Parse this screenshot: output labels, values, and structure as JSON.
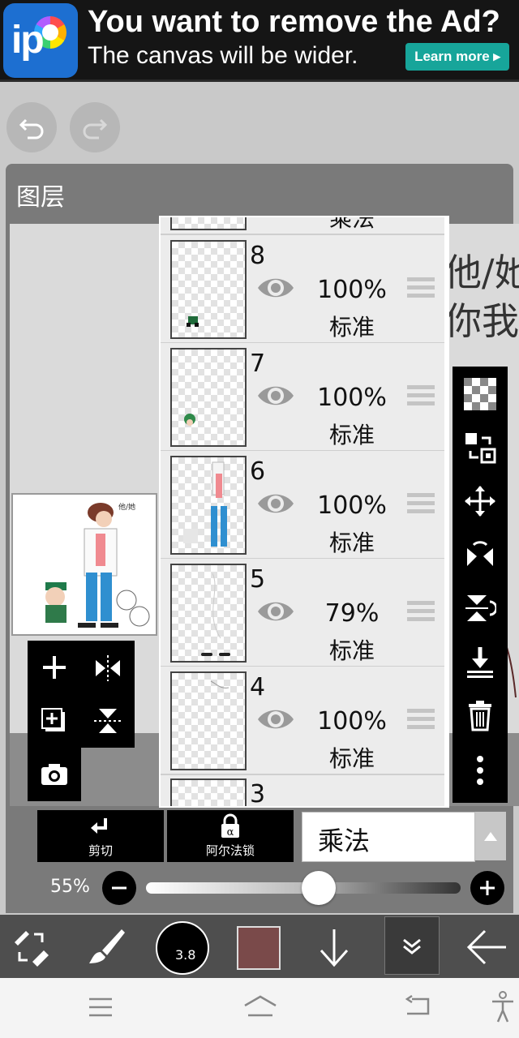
{
  "ad": {
    "title": "You want to remove the Ad?",
    "subtitle": "The canvas will be wider.",
    "button": "Learn more ▸",
    "logo_icon": "ibispaint-logo-icon"
  },
  "panel": {
    "title": "图层"
  },
  "handwriting": "他/她\n你我",
  "layers": [
    {
      "number": "8",
      "opacity": "100%",
      "mode": "标准"
    },
    {
      "number": "7",
      "opacity": "100%",
      "mode": "标准"
    },
    {
      "number": "6",
      "opacity": "100%",
      "mode": "标准"
    },
    {
      "number": "5",
      "opacity": "79%",
      "mode": "标准"
    },
    {
      "number": "4",
      "opacity": "100%",
      "mode": "标准"
    }
  ],
  "layer_partial_top": {
    "mode": "乘法"
  },
  "layer_partial_bottom": {
    "number": "3"
  },
  "bottom_controls": {
    "clipping_label": "剪切",
    "alpha_lock_label": "阿尔法锁",
    "blend_mode": "乘法",
    "opacity_label": "55%",
    "opacity_value": 0.55
  },
  "toolbar": {
    "brush_size": "3.8",
    "color": "#7a4a4a"
  }
}
